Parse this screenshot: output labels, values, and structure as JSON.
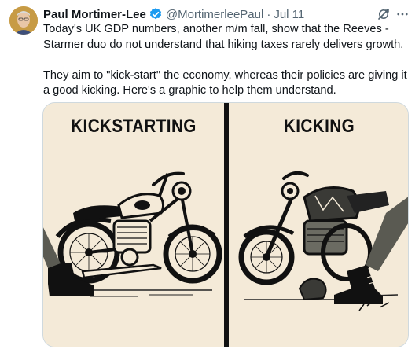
{
  "author": {
    "name": "Paul Mortimer-Lee",
    "handle": "@MortimerleePaul",
    "date": "Jul 11",
    "separator": "·"
  },
  "icons": {
    "verified": "verified-badge-icon",
    "grok": "grok-icon",
    "more": "more-options-icon"
  },
  "tweet": {
    "paragraph1": "Today's UK GDP numbers, another m/m fall, show that the  Reeves - Starmer duo do not understand that hiking taxes rarely delivers growth.",
    "paragraph2": "They aim to \"kick-start\"  the economy, whereas their policies are giving it a good kicking. Here's a graphic to help them understand."
  },
  "media": {
    "left_title": "KICKSTARTING",
    "right_title": "KICKING",
    "background": "#f4ead8"
  },
  "colors": {
    "verified": "#1d9bf0",
    "secondary_text": "#536471",
    "primary_text": "#0f1419"
  }
}
